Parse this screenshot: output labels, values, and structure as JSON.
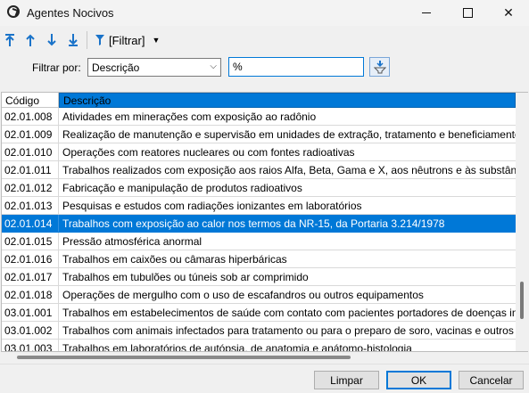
{
  "window": {
    "title": "Agentes Nocivos"
  },
  "toolbar": {
    "icons": [
      "move-first-icon",
      "move-up-icon",
      "move-down-icon",
      "move-last-icon",
      "filter-icon"
    ],
    "filter_label": "[Filtrar]"
  },
  "filter": {
    "label": "Filtrar por:",
    "field_value": "Descrição",
    "text_value": "%"
  },
  "grid": {
    "columns": [
      "Código",
      "Descrição"
    ],
    "rows": [
      {
        "code": "02.01.008",
        "desc": "Atividades em minerações com exposição ao radônio"
      },
      {
        "code": "02.01.009",
        "desc": "Realização de manutenção e supervisão em unidades de extração, tratamento e beneficiamento de minerais"
      },
      {
        "code": "02.01.010",
        "desc": "Operações com reatores nucleares ou com fontes radioativas"
      },
      {
        "code": "02.01.011",
        "desc": "Trabalhos realizados com exposição aos raios Alfa, Beta, Gama e X, aos nêutrons e às substâncias radioativas"
      },
      {
        "code": "02.01.012",
        "desc": "Fabricação e manipulação de produtos radioativos"
      },
      {
        "code": "02.01.013",
        "desc": "Pesquisas e estudos com radiações ionizantes em laboratórios"
      },
      {
        "code": "02.01.014",
        "desc": "Trabalhos com exposição ao calor nos termos da NR-15, da Portaria 3.214/1978"
      },
      {
        "code": "02.01.015",
        "desc": "Pressão atmosférica anormal"
      },
      {
        "code": "02.01.016",
        "desc": "Trabalhos em caixões ou câmaras hiperbáricas"
      },
      {
        "code": "02.01.017",
        "desc": "Trabalhos em tubulões ou túneis sob ar comprimido"
      },
      {
        "code": "02.01.018",
        "desc": "Operações de mergulho com o uso de escafandros ou outros equipamentos"
      },
      {
        "code": "03.01.001",
        "desc": "Trabalhos em estabelecimentos de saúde com contato com pacientes portadores de doenças infectocontagiosas"
      },
      {
        "code": "03.01.002",
        "desc": "Trabalhos com animais infectados para tratamento ou para o preparo de soro, vacinas e outros produtos"
      },
      {
        "code": "03.01.003",
        "desc": "Trabalhos em laboratórios de autópsia, de anatomia e anátomo-histologia"
      }
    ],
    "selected_code": "02.01.014"
  },
  "buttons": {
    "clear": "Limpar",
    "ok": "OK",
    "cancel": "Cancelar"
  },
  "colors": {
    "accent": "#0078d7",
    "selection": "#0078d7"
  }
}
